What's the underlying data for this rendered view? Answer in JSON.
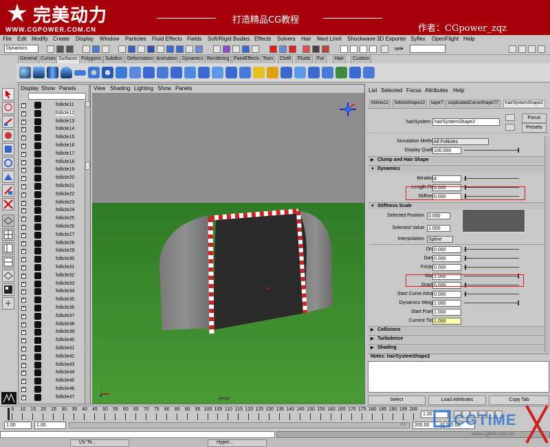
{
  "banner": {
    "logo_text": "完美动力",
    "logo_url": "WWW.CGPOWER.COM.CN",
    "slogan": "打造精品CG教程",
    "author": "作者：CGpower_zqz"
  },
  "menu": [
    "File",
    "Edit",
    "Modify",
    "Create",
    "Display",
    "Window",
    "Particles",
    "Fluid Effects",
    "Fields",
    "Soft/Rigid Bodies",
    "Effects",
    "Solvers",
    "Hair",
    "Next Limit",
    "Shockwave 3D Exporter",
    "Syflex",
    "OpenFlight",
    "Help"
  ],
  "status": {
    "module": "Dynamics",
    "sel_label": "sel▾"
  },
  "shelf_tabs": [
    "General",
    "Curves",
    "Surfaces",
    "Polygons",
    "Subdivs",
    "Deformation",
    "Animation",
    "Dynamics",
    "Rendering",
    "PaintEffects",
    "Toon",
    "Cloth",
    "Fluids",
    "Fur",
    "Hair",
    "Custom"
  ],
  "shelf_active": "Surfaces",
  "outliner": {
    "menu": [
      "Display",
      "Show",
      "Panels"
    ],
    "items": [
      "follicle11",
      "follicle12",
      "follicle13",
      "follicle14",
      "follicle15",
      "follicle16",
      "follicle17",
      "follicle18",
      "follicle19",
      "follicle20",
      "follicle21",
      "follicle22",
      "follicle23",
      "follicle24",
      "follicle25",
      "follicle26",
      "follicle27",
      "follicle28",
      "follicle29",
      "follicle30",
      "follicle31",
      "follicle32",
      "follicle33",
      "follicle34",
      "follicle35",
      "follicle36",
      "follicle37",
      "follicle38",
      "follicle39",
      "follicle40",
      "follicle41",
      "follicle42",
      "follicle43",
      "follicle44",
      "follicle45",
      "follicle46",
      "follicle47"
    ],
    "selected": "follicle12"
  },
  "viewport": {
    "menu": [
      "View",
      "Shading",
      "Lighting",
      "Show",
      "Panels"
    ],
    "camera_label": "persp"
  },
  "attr": {
    "menu": [
      "List",
      "Selected",
      "Focus",
      "Attributes",
      "Help"
    ],
    "tabs": [
      "follicle12",
      "follicleShape12",
      "layer7",
      "duplicatedCurveShape77",
      "hairSystemShape2"
    ],
    "node_label": "hairSystem:",
    "node_name": "hairSystemShape2",
    "focus_btn": "Focus",
    "presets_btn": "Presets",
    "sim_method_label": "Simulation Method",
    "sim_method": "All Follicles",
    "display_quality_label": "Display Quality",
    "display_quality": "100.000",
    "sec_clump": "Clump and Hair Shape",
    "sec_dynamics": "Dynamics",
    "iterations_label": "Iterations",
    "iterations": "4",
    "length_flex_label": "Length Flex",
    "length_flex": "0.000",
    "stiffness_label": "Stiffness",
    "stiffness": "0.000",
    "sec_stiffness_scale": "Stiffness Scale",
    "sel_pos_label": "Selected Position",
    "sel_pos": "0.000",
    "sel_val_label": "Selected Value",
    "sel_val": "1.000",
    "interp_label": "Interpolation",
    "interp": "Spline",
    "rows": [
      {
        "label": "Drag",
        "value": "0.000"
      },
      {
        "label": "Damp",
        "value": "0.000"
      },
      {
        "label": "Friction",
        "value": "0.000"
      },
      {
        "label": "Mass",
        "value": "1.000"
      },
      {
        "label": "Gravity",
        "value": "0.000"
      },
      {
        "label": "Start Curve Attract",
        "value": "0.000"
      },
      {
        "label": "Dynamics Weight",
        "value": "1.000"
      },
      {
        "label": "Start Frame",
        "value": "1.000"
      },
      {
        "label": "Current Time",
        "value": "1.000"
      }
    ],
    "sec_collisions": "Collisions",
    "sec_turbulence": "Turbulence",
    "sec_shading": "Shading",
    "notes_label": "Notes: hairSystemShape2",
    "select_btn": "Select",
    "load_btn": "Load Attributes",
    "copy_btn": "Copy Tab"
  },
  "timeline": {
    "ticks": [
      "5",
      "10",
      "15",
      "20",
      "25",
      "30",
      "35",
      "40",
      "45",
      "50",
      "55",
      "60",
      "65",
      "70",
      "75",
      "80",
      "85",
      "90",
      "95",
      "100",
      "105",
      "110",
      "115",
      "120",
      "125",
      "130",
      "135",
      "140",
      "145",
      "150",
      "155",
      "160",
      "165",
      "170",
      "175",
      "180",
      "185",
      "190",
      "195",
      "200"
    ],
    "current": "1.00"
  },
  "range": {
    "start": "1.00",
    "start2": "1.00",
    "end_label": "200",
    "end": "200.00",
    "end2": "200.00"
  },
  "taskbar": [
    "UV Te...",
    "Hyper..."
  ],
  "watermark": "CGTIME",
  "watermark_url": "www.cgtime.com.cn",
  "colors": {
    "banner": "#a80008",
    "highlight": "#e0141e",
    "grass": "#3f8a2c",
    "sky": "#8e8e8e"
  }
}
